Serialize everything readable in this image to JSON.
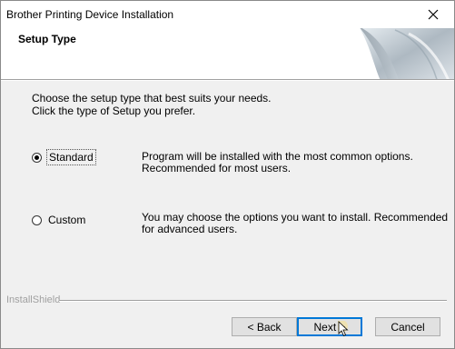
{
  "window": {
    "title": "Brother Printing Device Installation"
  },
  "header": {
    "title": "Setup Type"
  },
  "instructions": {
    "line1": "Choose the setup type that best suits your needs.",
    "line2": "Click the type of Setup you prefer."
  },
  "options": [
    {
      "label": "Standard",
      "selected": true,
      "description": "Program will be installed with the most common options. Recommended for most users."
    },
    {
      "label": "Custom",
      "selected": false,
      "description": "You may choose the options you want to install. Recommended for advanced users."
    }
  ],
  "footer": {
    "brand": "InstallShield"
  },
  "buttons": {
    "back": "< Back",
    "next": "Next >",
    "cancel": "Cancel"
  },
  "colors": {
    "focus_blue": "#0078d7",
    "brand_gray": "#a0a0a0"
  },
  "icons": {
    "close": "close-icon",
    "header_art": "page-curl-graphic"
  }
}
